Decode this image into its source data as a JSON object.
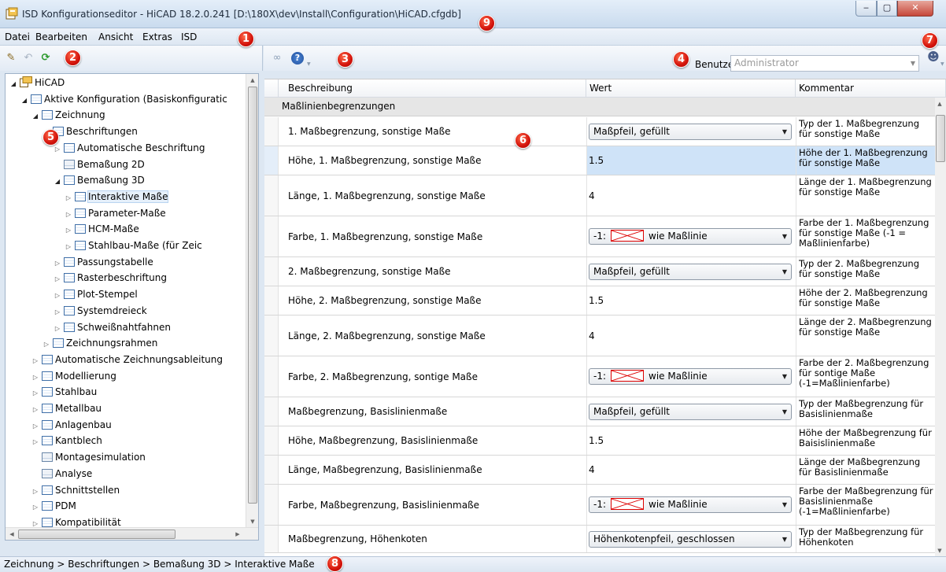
{
  "window": {
    "title": "ISD Konfigurationseditor  - HiCAD 18.2.0.241 [D:\\180X\\dev\\Install\\Configuration\\HiCAD.cfgdb]",
    "btn_min": "‒",
    "btn_max": "▢",
    "btn_close": "✕"
  },
  "menu": [
    "Datei",
    "Bearbeiten",
    "Ansicht",
    "Extras",
    "ISD"
  ],
  "badges": [
    "1",
    "2",
    "3",
    "4",
    "5",
    "6",
    "7",
    "8",
    "9"
  ],
  "user": {
    "label": "Benutzer",
    "value": "Administrator"
  },
  "tree": [
    {
      "label": "HiCAD",
      "level": 0,
      "toggle": "◢",
      "icon": "root"
    },
    {
      "label": "Aktive Konfiguration (Basiskonfiguratic",
      "level": 1,
      "toggle": "◢"
    },
    {
      "label": "Zeichnung",
      "level": 2,
      "toggle": "◢"
    },
    {
      "label": "Beschriftungen",
      "level": 3,
      "toggle": "◢"
    },
    {
      "label": "Automatische Beschriftung",
      "level": 4,
      "toggle": "▷"
    },
    {
      "label": "Bemaßung 2D",
      "level": 4,
      "toggle": ""
    },
    {
      "label": "Bemaßung 3D",
      "level": 4,
      "toggle": "◢"
    },
    {
      "label": "Interaktive Maße",
      "level": 5,
      "toggle": "▷",
      "selected": true
    },
    {
      "label": "Parameter-Maße",
      "level": 5,
      "toggle": "▷"
    },
    {
      "label": "HCM-Maße",
      "level": 5,
      "toggle": "▷"
    },
    {
      "label": "Stahlbau-Maße (für Zeic",
      "level": 5,
      "toggle": "▷"
    },
    {
      "label": "Passungstabelle",
      "level": 4,
      "toggle": "▷"
    },
    {
      "label": "Rasterbeschriftung",
      "level": 4,
      "toggle": "▷"
    },
    {
      "label": "Plot-Stempel",
      "level": 4,
      "toggle": "▷"
    },
    {
      "label": "Systemdreieck",
      "level": 4,
      "toggle": "▷"
    },
    {
      "label": "Schweißnahtfahnen",
      "level": 4,
      "toggle": "▷"
    },
    {
      "label": "Zeichnungsrahmen",
      "level": 3,
      "toggle": "▷"
    },
    {
      "label": "Automatische Zeichnungsableitung",
      "level": 2,
      "toggle": "▷"
    },
    {
      "label": "Modellierung",
      "level": 2,
      "toggle": "▷"
    },
    {
      "label": "Stahlbau",
      "level": 2,
      "toggle": "▷"
    },
    {
      "label": "Metallbau",
      "level": 2,
      "toggle": "▷"
    },
    {
      "label": "Anlagenbau",
      "level": 2,
      "toggle": "▷"
    },
    {
      "label": "Kantblech",
      "level": 2,
      "toggle": "▷"
    },
    {
      "label": "Montagesimulation",
      "level": 2,
      "toggle": ""
    },
    {
      "label": "Analyse",
      "level": 2,
      "toggle": ""
    },
    {
      "label": "Schnittstellen",
      "level": 2,
      "toggle": "▷"
    },
    {
      "label": "PDM",
      "level": 2,
      "toggle": "▷"
    },
    {
      "label": "Kompatibilität",
      "level": 2,
      "toggle": "▷"
    }
  ],
  "grid": {
    "headers": [
      "Beschreibung",
      "Wert",
      "Kommentar"
    ],
    "group": "Maßlinienbegrenzungen",
    "rows": [
      {
        "desc": "1. Maßbegrenzung, sonstige Maße",
        "type": "combo",
        "value": "Maßpfeil, gefüllt",
        "comment": "Typ der 1. Maßbegrenzung für sonstige Maße"
      },
      {
        "desc": "Höhe, 1. Maßbegrenzung, sonstige Maße",
        "type": "text",
        "value": "1.5",
        "comment": "Höhe der 1. Maßbegrenzung für sonstige Maße",
        "selected": true
      },
      {
        "desc": "Länge, 1. Maßbegrenzung, sonstige Maße",
        "type": "text",
        "value": "4",
        "comment": "Länge der 1. Maßbegrenzung für sonstige Maße"
      },
      {
        "desc": "Farbe, 1. Maßbegrenzung, sonstige Maße",
        "type": "color",
        "prefix": "-1:",
        "value": "wie Maßlinie",
        "comment": "Farbe der 1. Maßbegrenzung für sonstige Maße (-1 = Maßlinienfarbe)"
      },
      {
        "desc": "2. Maßbegrenzung, sonstige Maße",
        "type": "combo",
        "value": "Maßpfeil, gefüllt",
        "comment": "Typ der 2. Maßbegrenzung für sonstige Maße"
      },
      {
        "desc": "Höhe, 2. Maßbegrenzung, sonstige Maße",
        "type": "text",
        "value": "1.5",
        "comment": "Höhe der 2. Maßbegrenzung für sonstige Maße"
      },
      {
        "desc": "Länge, 2. Maßbegrenzung, sonstige Maße",
        "type": "text",
        "value": "4",
        "comment": "Länge der 2. Maßbegrenzung für sonstige Maße"
      },
      {
        "desc": "Farbe, 2. Maßbegrenzung, sontige Maße",
        "type": "color",
        "prefix": "-1:",
        "value": "wie Maßlinie",
        "comment": "Farbe der 2. Maßbegrenzung für sontige Maße (-1=Maßlinienfarbe)"
      },
      {
        "desc": "Maßbegrenzung, Basislinienmaße",
        "type": "combo",
        "value": "Maßpfeil, gefüllt",
        "comment": "Typ der Maßbegrenzung für Basislinienmaße"
      },
      {
        "desc": "Höhe, Maßbegrenzung, Basislinienmaße",
        "type": "text",
        "value": "1.5",
        "comment": "Höhe der Maßbegrenzung für Baisislinienmaße"
      },
      {
        "desc": "Länge, Maßbegrenzung, Basislinienmaße",
        "type": "text",
        "value": "4",
        "comment": "Länge der Maßbegrenzung für Basislinienmaße"
      },
      {
        "desc": "Farbe, Maßbegrenzung, Basislinienmaße",
        "type": "color",
        "prefix": "-1:",
        "value": "wie Maßlinie",
        "comment": "Farbe der Maßbegrenzung für Basislinienmaße (-1=Maßlinienfarbe)"
      },
      {
        "desc": "Maßbegrenzung, Höhenkoten",
        "type": "combo",
        "value": "Höhenkotenpfeil, geschlossen",
        "comment": "Typ der Maßbegrenzung für Höhenkoten"
      }
    ]
  },
  "statusbar": "Zeichnung > Beschriftungen > Bemaßung 3D > Interaktive Maße",
  "colors": {
    "badge": "#d3130b",
    "selection": "#cfe3f8",
    "colorbox_border": "#dd0000"
  }
}
